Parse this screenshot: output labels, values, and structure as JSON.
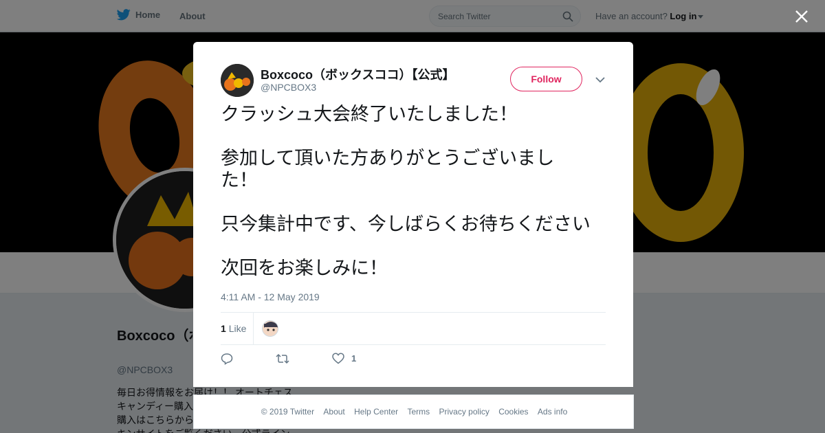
{
  "topbar": {
    "home_label": "Home",
    "about_label": "About",
    "search_placeholder": "Search Twitter",
    "account_prompt": "Have an account?",
    "login_label": "Log in"
  },
  "profile": {
    "name": "Boxcoco（ボックスココ）【公式】",
    "handle": "@NPCBOX3",
    "bio": "毎日お得情報をお届け！！ オートチェス\nキャンディー購入\n購入はこちらから\nキンサイトをご覧ください。公式ライン"
  },
  "tweet": {
    "author_name": "Boxcoco（ボックスココ）【公式】",
    "author_handle": "@NPCBOX3",
    "follow_label": "Follow",
    "text_lines": [
      "クラッシュ大会終了いたしました！",
      "参加して頂いた方ありがとうございまし",
      "た！",
      "只今集計中です、今しばらくお待ちください",
      "次回をお楽しみに！"
    ],
    "timestamp": "4:11 AM - 12 May 2019",
    "likes_count": "1",
    "likes_label": "Like",
    "reply_count": "",
    "retweet_count": "",
    "like_action_count": "1"
  },
  "footer": {
    "links": [
      "© 2019 Twitter",
      "About",
      "Help Center",
      "Terms",
      "Privacy policy",
      "Cookies",
      "Ads info"
    ]
  },
  "colors": {
    "twitter_blue": "#1da1f2",
    "follow_accent": "#e0245e",
    "muted_text": "#657786"
  },
  "icons": {
    "brand": "twitter-bird-icon",
    "search": "search-icon",
    "close": "close-icon",
    "more": "chevron-down-icon",
    "reply": "reply-icon",
    "retweet": "retweet-icon",
    "like": "heart-icon"
  }
}
